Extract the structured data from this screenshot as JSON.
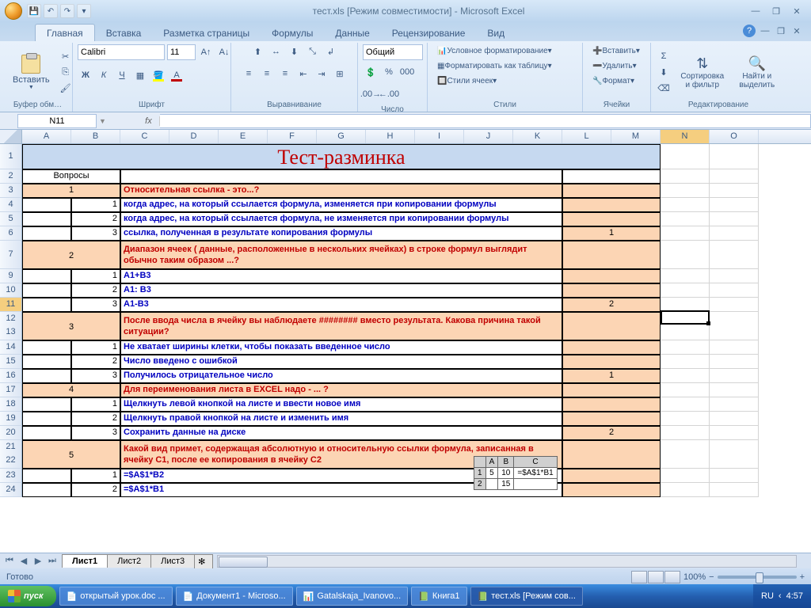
{
  "window": {
    "title": "тест.xls  [Режим совместимости] - Microsoft Excel"
  },
  "tabs": [
    "Главная",
    "Вставка",
    "Разметка страницы",
    "Формулы",
    "Данные",
    "Рецензирование",
    "Вид"
  ],
  "ribbon": {
    "clipboard": {
      "paste": "Вставить",
      "label": "Буфер обм…"
    },
    "font": {
      "name": "Calibri",
      "size": "11",
      "label": "Шрифт"
    },
    "align": {
      "label": "Выравнивание"
    },
    "number": {
      "format": "Общий",
      "label": "Число"
    },
    "styles": {
      "cond": "Условное форматирование",
      "fmt": "Форматировать как таблицу",
      "cell": "Стили ячеек",
      "label": "Стили"
    },
    "cells": {
      "ins": "Вставить",
      "del": "Удалить",
      "fmt": "Формат",
      "label": "Ячейки"
    },
    "editing": {
      "sort": "Сортировка и фильтр",
      "find": "Найти и выделить",
      "label": "Редактирование"
    }
  },
  "namebox": "N11",
  "columns": [
    "A",
    "B",
    "C",
    "D",
    "E",
    "F",
    "G",
    "H",
    "I",
    "J",
    "K",
    "L",
    "M",
    "N",
    "O"
  ],
  "sheet": {
    "title": "Тест-разминка",
    "q_header": "Вопросы",
    "q1": {
      "num": "1",
      "text": "Относительная ссылка - это...?",
      "a": [
        {
          "n": "1",
          "t": "когда адрес, на который ссылается формула, изменяется при копировании формулы"
        },
        {
          "n": "2",
          "t": "когда адрес, на который ссылается формула, не изменяется при копировании формулы"
        },
        {
          "n": "3",
          "t": "ссылка, полученная в результате копирования формулы"
        }
      ],
      "ans": "1"
    },
    "q2": {
      "num": "2",
      "text": "Диапазон ячеек ( данные, расположенные в нескольких ячейках) в строке формул выглядит обычно таким образом ...?",
      "a": [
        {
          "n": "1",
          "t": "A1+B3"
        },
        {
          "n": "2",
          "t": "A1: B3"
        },
        {
          "n": "3",
          "t": "A1-B3"
        }
      ],
      "ans": "2"
    },
    "q3": {
      "num": "3",
      "text": "После ввода числа в ячейку вы наблюдаете ######## вместо результата. Какова причина такой ситуации?",
      "a": [
        {
          "n": "1",
          "t": "Не хватает ширины клетки, чтобы показать введенное число"
        },
        {
          "n": "2",
          "t": "Число введено с ошибкой"
        },
        {
          "n": "3",
          "t": "Получилось отрицательное число"
        }
      ],
      "ans": "1"
    },
    "q4": {
      "num": "4",
      "text": "Для переименования листа в EXCEL надо - ... ?",
      "a": [
        {
          "n": "1",
          "t": "Щелкнуть левой кнопкой на листе и ввести новое имя"
        },
        {
          "n": "2",
          "t": "Щелкнуть правой кнопкой на листе и изменить имя"
        },
        {
          "n": "3",
          "t": "Сохранить данные на диске"
        }
      ],
      "ans": "2"
    },
    "q5": {
      "num": "5",
      "text": "Какой вид примет, содержащая абсолютную и относительную ссылки формула, записанная в ячейку C1, после ее копирования в ячейку C2",
      "a": [
        {
          "n": "1",
          "t": "=$A$1*B2"
        },
        {
          "n": "2",
          "t": "=$A$1*B1"
        }
      ]
    },
    "inline_table": {
      "cols": [
        "",
        "A",
        "B",
        "C"
      ],
      "rows": [
        [
          "1",
          "5",
          "10",
          "=$A$1*B1"
        ],
        [
          "2",
          "",
          "15",
          ""
        ]
      ]
    }
  },
  "sheets": [
    "Лист1",
    "Лист2",
    "Лист3"
  ],
  "status": {
    "ready": "Готово",
    "zoom": "100%"
  },
  "taskbar": {
    "start": "пуск",
    "items": [
      "открытый урок.doc ...",
      "Документ1 - Microso...",
      "Gatalskaja_Ivanovo...",
      "Книга1",
      "тест.xls  [Режим сов..."
    ],
    "lang": "RU",
    "time": "4:57"
  }
}
